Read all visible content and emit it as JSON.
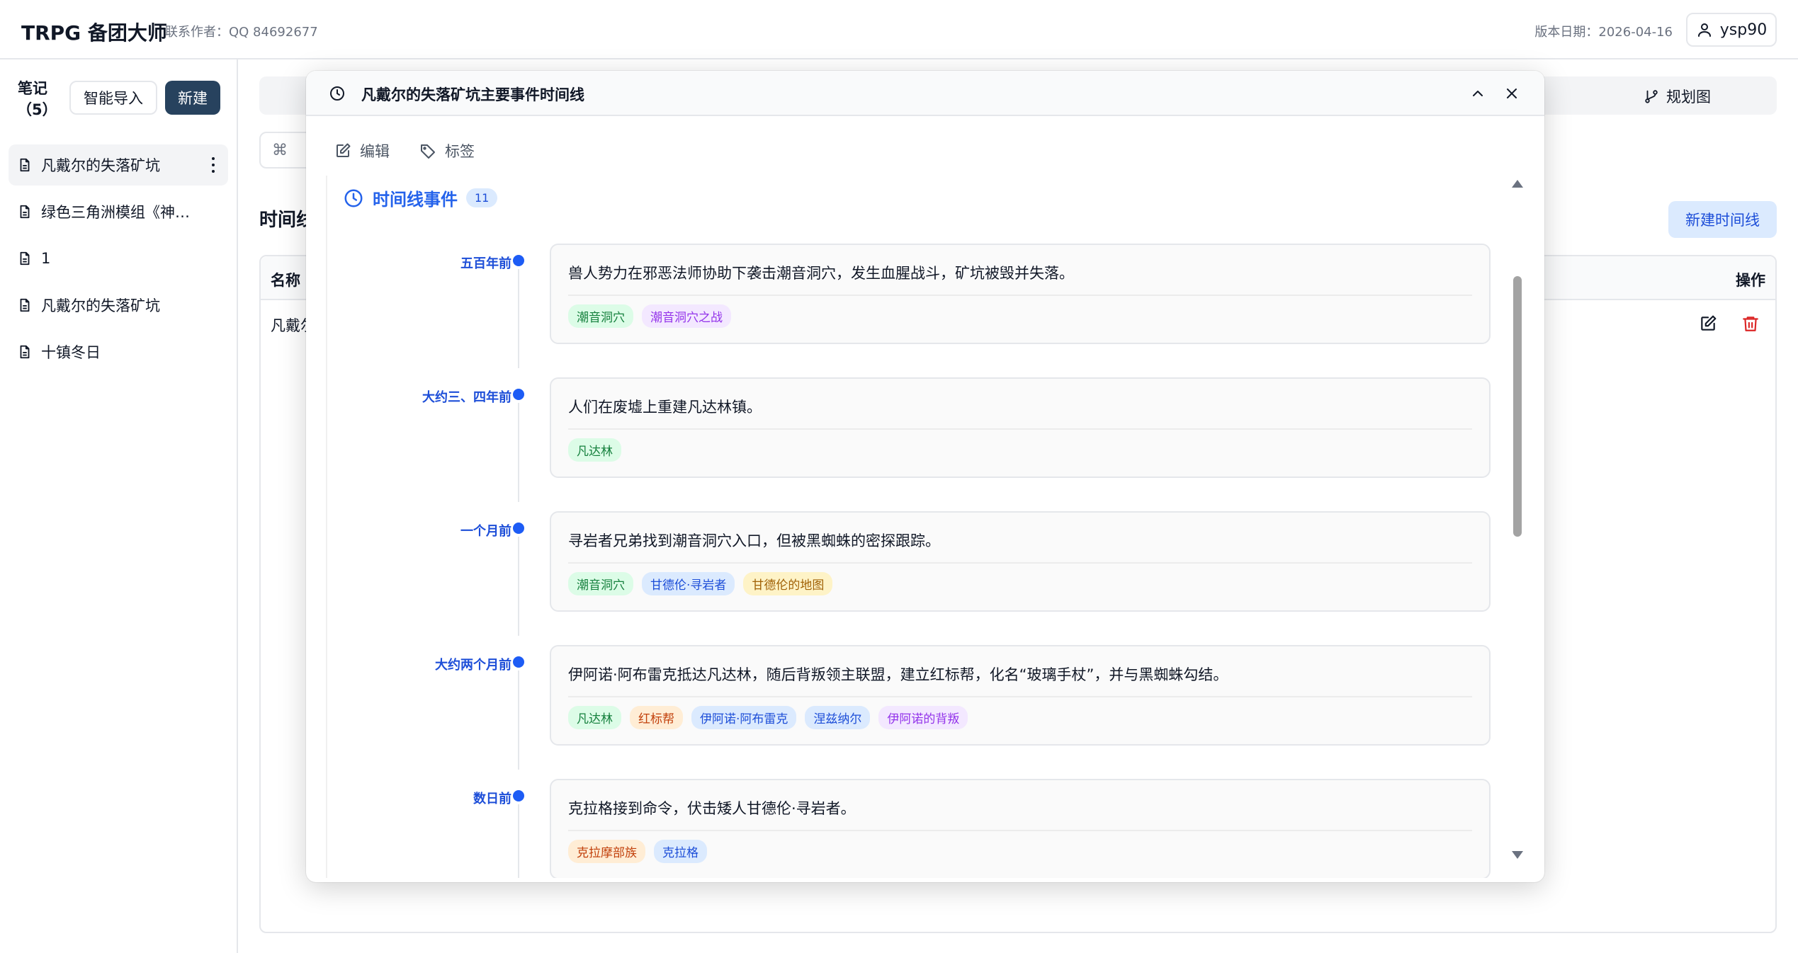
{
  "header": {
    "title": "TRPG 备团大师",
    "contact": "联系作者：QQ 84692677",
    "version": "版本日期：2026-04-16",
    "username": "ysp90"
  },
  "sidebar": {
    "notes_label": "笔记（5）",
    "import_label": "智能导入",
    "new_label": "新建",
    "items": [
      {
        "label": "凡戴尔的失落矿坑"
      },
      {
        "label": "绿色三角洲模组《神秘的废墟》"
      },
      {
        "label": "1"
      },
      {
        "label": "凡戴尔的失落矿坑"
      },
      {
        "label": "十镇冬日"
      }
    ]
  },
  "main": {
    "planning_label": "规划图",
    "cmd_label": "⌘",
    "section_title": "时间线",
    "new_timeline_label": "新建时间线",
    "table": {
      "col_name": "名称",
      "col_ops": "操作",
      "row_name": "凡戴尔"
    }
  },
  "modal": {
    "title": "凡戴尔的失落矿坑主要事件时间线",
    "edit_label": "编辑",
    "tags_label": "标签",
    "events_heading": "时间线事件",
    "events_count": "11",
    "events": [
      {
        "time": "五百年前",
        "text": "兽人势力在邪恶法师协助下袭击潮音洞穴，发生血腥战斗，矿坑被毁并失落。",
        "tags": [
          {
            "label": "潮音洞穴",
            "color": "green"
          },
          {
            "label": "潮音洞穴之战",
            "color": "purple"
          }
        ]
      },
      {
        "time": "大约三、四年前",
        "text": "人们在废墟上重建凡达林镇。",
        "tags": [
          {
            "label": "凡达林",
            "color": "green"
          }
        ]
      },
      {
        "time": "一个月前",
        "text": "寻岩者兄弟找到潮音洞穴入口，但被黑蜘蛛的密探跟踪。",
        "tags": [
          {
            "label": "潮音洞穴",
            "color": "green"
          },
          {
            "label": "甘德伦·寻岩者",
            "color": "blue"
          },
          {
            "label": "甘德伦的地图",
            "color": "yellow"
          }
        ]
      },
      {
        "time": "大约两个月前",
        "text": "伊阿诺·阿布雷克抵达凡达林，随后背叛领主联盟，建立红标帮，化名“玻璃手杖”，并与黑蜘蛛勾结。",
        "tags": [
          {
            "label": "凡达林",
            "color": "green"
          },
          {
            "label": "红标帮",
            "color": "orange"
          },
          {
            "label": "伊阿诺·阿布雷克",
            "color": "blue"
          },
          {
            "label": "涅兹纳尔",
            "color": "blue"
          },
          {
            "label": "伊阿诺的背叛",
            "color": "purple"
          }
        ]
      },
      {
        "time": "数日前",
        "text": "克拉格接到命令，伏击矮人甘德伦·寻岩者。",
        "tags": [
          {
            "label": "克拉摩部族",
            "color": "orange"
          },
          {
            "label": "克拉格",
            "color": "blue"
          }
        ]
      }
    ]
  }
}
